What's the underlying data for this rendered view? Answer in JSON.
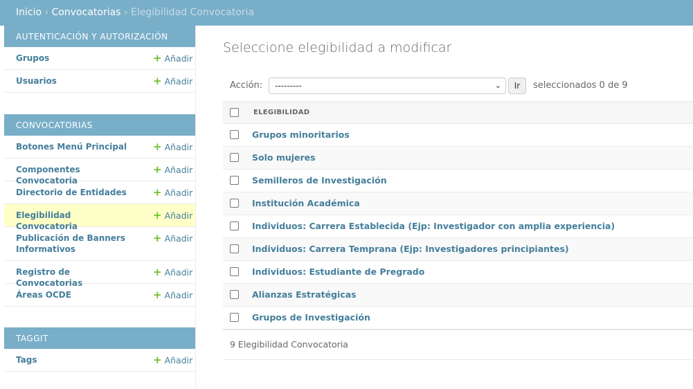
{
  "breadcrumbs": {
    "items": [
      "Inicio",
      "Convocatorias"
    ],
    "current": "Elegibilidad Convocatoria",
    "separator": "›"
  },
  "sidebar": {
    "add_label": "Añadir",
    "modules": [
      {
        "caption": "Autenticación y autorización",
        "items": [
          {
            "label": "Grupos"
          },
          {
            "label": "Usuarios"
          }
        ]
      },
      {
        "caption": "Convocatorias",
        "items": [
          {
            "label": "Botones Menú Principal"
          },
          {
            "label": "Componentes Convocatoria"
          },
          {
            "label": "Directorio de Entidades"
          },
          {
            "label": "Elegibilidad Convocatoria"
          },
          {
            "label": "Publicación de Banners Informativos"
          },
          {
            "label": "Registro de Convocatorias"
          },
          {
            "label": "Áreas OCDE"
          }
        ]
      },
      {
        "caption": "Taggit",
        "items": [
          {
            "label": "Tags"
          }
        ]
      }
    ]
  },
  "main": {
    "title": "Seleccione elegibilidad a modificar",
    "action_label": "Acción:",
    "action_value": "---------",
    "go_label": "Ir",
    "selection_counter": "seleccionados 0 de 9",
    "column_header": "Elegibilidad",
    "rows": [
      "Grupos minoritarios",
      "Solo mujeres",
      "Semilleros de Investigación",
      "Institución Académica",
      "Individuos: Carrera Establecida (Ejp: Investigador con amplia experiencia)",
      "Individuos: Carrera Temprana (Ejp: Investigadores principiantes)",
      "Individuos: Estudiante de Pregrado",
      "Alianzas Estratégicas",
      "Grupos de Investigación"
    ],
    "paginator": "9 Elegibilidad Convocatoria"
  },
  "colors": {
    "header_bg": "#79aec8",
    "link": "#447e9b",
    "add_plus": "#70bf2b",
    "active_row": "#ffffc8"
  },
  "icons": {
    "add": "plus-icon",
    "select": "chevron-down-icon"
  }
}
